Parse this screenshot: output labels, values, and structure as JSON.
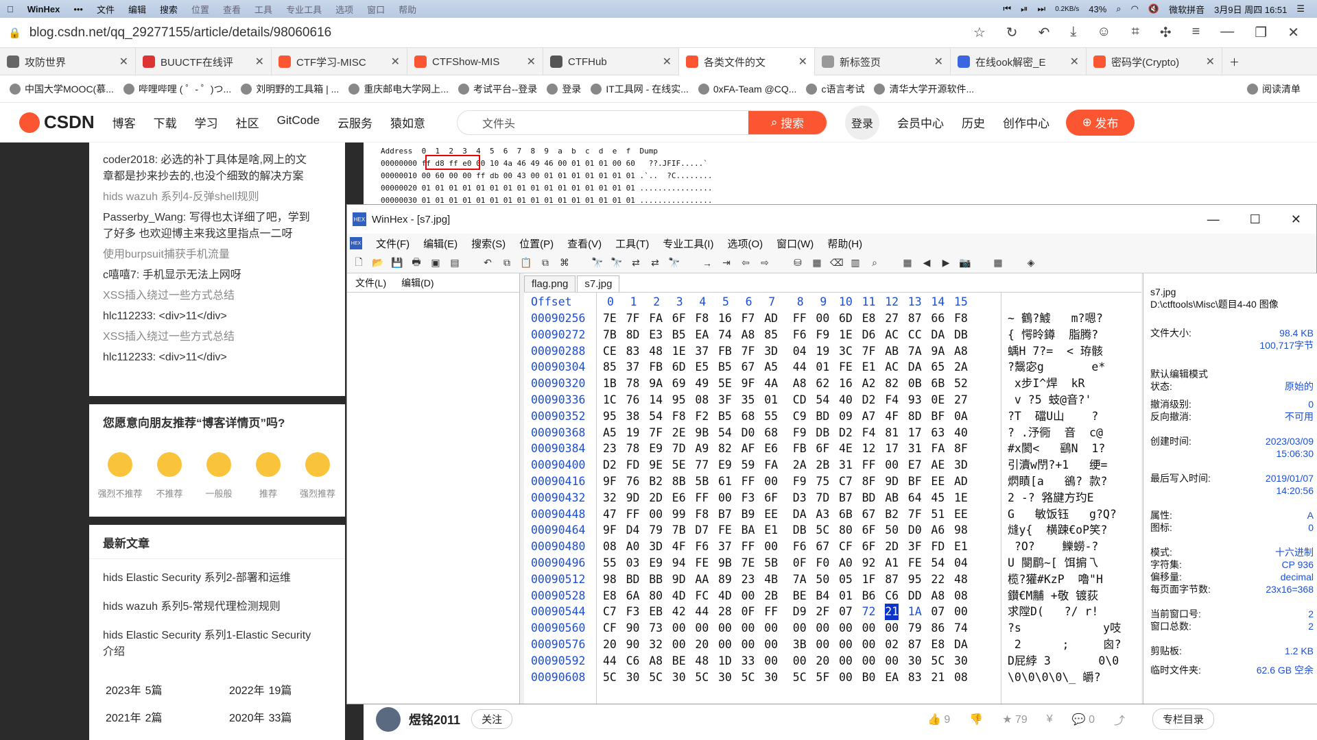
{
  "system": {
    "app_name": "WinHex",
    "menus": [
      "文件",
      "编辑",
      "搜索",
      "位置",
      "查看",
      "工具",
      "专业工具",
      "选项",
      "窗口",
      "帮助"
    ],
    "net_speed": "0.2KB/s",
    "battery": "43%",
    "ime": "微软拼音",
    "clock": "3月9日 周四 16:51"
  },
  "browser": {
    "url": "blog.csdn.net/qq_29277155/article/details/98060616",
    "tabs": [
      {
        "label": "攻防世界",
        "color": "#666"
      },
      {
        "label": "BUUCTF在线评",
        "color": "#d33"
      },
      {
        "label": "CTF学习-MISC",
        "color": "#fc5531"
      },
      {
        "label": "CTFShow-MIS",
        "color": "#fc5531"
      },
      {
        "label": "CTFHub",
        "color": "#555"
      },
      {
        "label": "各类文件的文",
        "color": "#fc5531"
      },
      {
        "label": "新标签页",
        "color": "#999"
      },
      {
        "label": "在线ook解密_E",
        "color": "#3a66e0"
      },
      {
        "label": "密码学(Crypto)",
        "color": "#fc5531"
      }
    ],
    "bookmarks": [
      "中国大学MOOC(慕...",
      "哔哩哔哩 ( ゜- ゜)つ...",
      "刘明野的工具箱 | ...",
      "重庆邮电大学网上...",
      "考试平台--登录",
      "登录",
      "IT工具网 - 在线实...",
      "0xFA-Team @CQ...",
      "c语言考试",
      "清华大学开源软件...",
      "阅读清单"
    ]
  },
  "csdn": {
    "logo": "CSDN",
    "nav": [
      "博客",
      "下载",
      "学习",
      "社区",
      "GitCode",
      "云服务",
      "猿如意"
    ],
    "search_placeholder": "文件头",
    "search_button": "搜索",
    "login": "登录",
    "right_nav": [
      "会员中心",
      "历史",
      "创作中心"
    ],
    "publish": "发布"
  },
  "sidebar": {
    "comments": [
      {
        "title": "coder2018: 必选的补丁具体是啥,网上的文",
        "title2": "章都是抄来抄去的,也没个细致的解决方案"
      },
      {
        "title": "hids wazuh 系列4-反弹shell规则"
      },
      {
        "title": "Passerby_Wang: 写得也太详细了吧，学到",
        "title2": "了好多 也欢迎博主来我这里指点一二呀"
      },
      {
        "title": "使用burpsuit捕获手机流量"
      },
      {
        "title": "c嘻嘻7: 手机显示无法上网呀"
      },
      {
        "title": "XSS插入绕过一些方式总结"
      },
      {
        "title": "hlc112233: <div>11</div>"
      },
      {
        "title": "XSS插入绕过一些方式总结"
      },
      {
        "title": "hlc112233: <div>11</div>"
      }
    ],
    "recommend_title": "您愿意向朋友推荐“博客详情页”吗?",
    "ratings": [
      "强烈不推荐",
      "不推荐",
      "一般般",
      "推荐",
      "强烈推荐"
    ],
    "latest_title": "最新文章",
    "latest": [
      "hids Elastic Security 系列2-部署和运维",
      "hids wazuh 系列5-常规代理检测规则",
      "hids Elastic Security 系列1-Elastic Security",
      "介绍"
    ],
    "archive": [
      {
        "year": "2023年",
        "count": "5篇"
      },
      {
        "year": "2022年",
        "count": "19篇"
      },
      {
        "year": "2021年",
        "count": "2篇"
      },
      {
        "year": "2020年",
        "count": "33篇"
      }
    ]
  },
  "snippet": {
    "header": "Address  0  1  2  3  4  5  6  7  8  9  a  b  c  d  e  f  Dump",
    "rows": [
      "00000000 ff d8 ff e0 00 10 4a 46 49 46 00 01 01 01 00 60   ??.JFIF.....`",
      "00000010 00 60 00 00 ff db 00 43 00 01 01 01 01 01 01 01 .`..  ?C........",
      "00000020 01 01 01 01 01 01 01 01 01 01 01 01 01 01 01 01 ................",
      "00000030 01 01 01 01 01 01 01 01 01 01 01 01 01 01 01 01 ................"
    ]
  },
  "author": {
    "name": "煜铭2011",
    "follow": "关注",
    "likes": "9",
    "stars": "79",
    "comments": "0",
    "column": "专栏目录"
  },
  "winhex": {
    "title": "WinHex - [s7.jpg]",
    "menu": [
      "文件(F)",
      "编辑(E)",
      "搜索(S)",
      "位置(P)",
      "查看(V)",
      "工具(T)",
      "专业工具(I)",
      "选项(O)",
      "窗口(W)",
      "帮助(H)"
    ],
    "left_menu": [
      "文件(L)",
      "编辑(D)"
    ],
    "file_tabs": [
      "flag.png",
      "s7.jpg"
    ],
    "offset_label": "Offset",
    "col_heads": [
      "0",
      "1",
      "2",
      "3",
      "4",
      "5",
      "6",
      "7",
      "8",
      "9",
      "10",
      "11",
      "12",
      "13",
      "14",
      "15"
    ],
    "rows": [
      {
        "off": "00090256",
        "bytes": [
          "7E",
          "7F",
          "FA",
          "6F",
          "F8",
          "16",
          "F7",
          "AD",
          "FF",
          "00",
          "6D",
          "E8",
          "27",
          "87",
          "66",
          "F8"
        ],
        "text": "~ 鶴?鰬   m?嗯?"
      },
      {
        "off": "00090272",
        "bytes": [
          "7B",
          "8D",
          "E3",
          "B5",
          "EA",
          "74",
          "A8",
          "85",
          "F6",
          "F9",
          "1E",
          "D6",
          "AC",
          "CC",
          "DA",
          "DB"
        ],
        "text": "{ 愕昤鐏  脂腾?"
      },
      {
        "off": "00090288",
        "bytes": [
          "CE",
          "83",
          "48",
          "1E",
          "37",
          "FB",
          "7F",
          "3D",
          "04",
          "19",
          "3C",
          "7F",
          "AB",
          "7A",
          "9A",
          "A8"
        ],
        "text": "蝺H 7?=  < 珔骸"
      },
      {
        "off": "00090304",
        "bytes": [
          "85",
          "37",
          "FB",
          "6D",
          "E5",
          "B5",
          "67",
          "A5",
          "44",
          "01",
          "FE",
          "E1",
          "AC",
          "DA",
          "65",
          "2A"
        ],
        "text": "?鬶宓g       e*"
      },
      {
        "off": "00090320",
        "bytes": [
          "1B",
          "78",
          "9A",
          "69",
          "49",
          "5E",
          "9F",
          "4A",
          "A8",
          "62",
          "16",
          "A2",
          "82",
          "0B",
          "6B",
          "52"
        ],
        "text": " x步I^焊  kR"
      },
      {
        "off": "00090336",
        "bytes": [
          "1C",
          "76",
          "14",
          "95",
          "08",
          "3F",
          "35",
          "01",
          "CD",
          "54",
          "40",
          "D2",
          "F4",
          "93",
          "0E",
          "27"
        ],
        "text": " v ?5 蚑@音?'"
      },
      {
        "off": "00090352",
        "bytes": [
          "95",
          "38",
          "54",
          "F8",
          "F2",
          "B5",
          "68",
          "55",
          "C9",
          "BD",
          "09",
          "A7",
          "4F",
          "8D",
          "BF",
          "0A"
        ],
        "text": "?T  礑U山    ?"
      },
      {
        "off": "00090368",
        "bytes": [
          "A5",
          "19",
          "7F",
          "2E",
          "9B",
          "54",
          "D0",
          "68",
          "F9",
          "DB",
          "D2",
          "F4",
          "81",
          "17",
          "63",
          "40"
        ],
        "text": "? .汿衕  音  c@"
      },
      {
        "off": "00090384",
        "bytes": [
          "23",
          "78",
          "E9",
          "7D",
          "A9",
          "82",
          "AF",
          "E6",
          "FB",
          "6F",
          "4E",
          "12",
          "17",
          "31",
          "FA",
          "8F"
        ],
        "text": "#x閡<   鷂N  1?"
      },
      {
        "off": "00090400",
        "bytes": [
          "D2",
          "FD",
          "9E",
          "5E",
          "77",
          "E9",
          "59",
          "FA",
          "2A",
          "2B",
          "31",
          "FF",
          "00",
          "E7",
          "AE",
          "3D"
        ],
        "text": "引瀆w閅?+1   绠="
      },
      {
        "off": "00090416",
        "bytes": [
          "9F",
          "76",
          "B2",
          "8B",
          "5B",
          "61",
          "FF",
          "00",
          "F9",
          "75",
          "C7",
          "8F",
          "9D",
          "BF",
          "EE",
          "AD"
        ],
        "text": "熌瞔[a   鵒? 款?"
      },
      {
        "off": "00090432",
        "bytes": [
          "32",
          "9D",
          "2D",
          "E6",
          "FF",
          "00",
          "F3",
          "6F",
          "D3",
          "7D",
          "B7",
          "BD",
          "AB",
          "64",
          "45",
          "1E"
        ],
        "text": "2 -? 嗠旔方玓E"
      },
      {
        "off": "00090448",
        "bytes": [
          "47",
          "FF",
          "00",
          "99",
          "F8",
          "B7",
          "B9",
          "EE",
          "DA",
          "A3",
          "6B",
          "67",
          "B2",
          "7F",
          "51",
          "EE"
        ],
        "text": "G   敏饭钰   g?Q?"
      },
      {
        "off": "00090464",
        "bytes": [
          "9F",
          "D4",
          "79",
          "7B",
          "D7",
          "FE",
          "BA",
          "E1",
          "DB",
          "5C",
          "80",
          "6F",
          "50",
          "D0",
          "A6",
          "98"
        ],
        "text": "熢y{  横踈€oP笑?"
      },
      {
        "off": "00090480",
        "bytes": [
          "08",
          "A0",
          "3D",
          "4F",
          "F6",
          "37",
          "FF",
          "00",
          "F6",
          "67",
          "CF",
          "6F",
          "2D",
          "3F",
          "FD",
          "E1"
        ],
        "text": " ?O?    鱳蟧-?"
      },
      {
        "off": "00090496",
        "bytes": [
          "55",
          "03",
          "E9",
          "94",
          "FE",
          "9B",
          "7E",
          "5B",
          "0F",
          "F0",
          "A0",
          "92",
          "A1",
          "FE",
          "54",
          "04"
        ],
        "text": "U 閿鹛~[ 饵掮乁"
      },
      {
        "off": "00090512",
        "bytes": [
          "98",
          "BD",
          "BB",
          "9D",
          "AA",
          "89",
          "23",
          "4B",
          "7A",
          "50",
          "05",
          "1F",
          "87",
          "95",
          "22",
          "48"
        ],
        "text": "榄?獾#KzP  嚕\"H"
      },
      {
        "off": "00090528",
        "bytes": [
          "E8",
          "6A",
          "80",
          "4D",
          "FC",
          "4D",
          "00",
          "2B",
          "BE",
          "B4",
          "01",
          "B6",
          "C6",
          "DD",
          "A8",
          "08"
        ],
        "text": "鑚€M黼 +敬 镀荻"
      },
      {
        "off": "00090544",
        "bytes": [
          "C7",
          "F3",
          "EB",
          "42",
          "44",
          "28",
          "0F",
          "FF",
          "D9",
          "2F",
          "07",
          "72",
          "21",
          "1A",
          "07",
          "00"
        ],
        "text": "求隚D(   ?/ r!"
      },
      {
        "off": "00090560",
        "bytes": [
          "CF",
          "90",
          "73",
          "00",
          "00",
          "00",
          "00",
          "00",
          "00",
          "00",
          "00",
          "00",
          "00",
          "79",
          "86",
          "74"
        ],
        "text": "?s            y吱"
      },
      {
        "off": "00090576",
        "bytes": [
          "20",
          "90",
          "32",
          "00",
          "20",
          "00",
          "00",
          "00",
          "3B",
          "00",
          "00",
          "00",
          "02",
          "87",
          "E8",
          "DA"
        ],
        "text": " 2      ;     囪?"
      },
      {
        "off": "00090592",
        "bytes": [
          "44",
          "C6",
          "A8",
          "BE",
          "48",
          "1D",
          "33",
          "00",
          "00",
          "20",
          "00",
          "00",
          "00",
          "30",
          "5C",
          "30"
        ],
        "text": "D屁綍 3       0\\0"
      },
      {
        "off": "00090608",
        "bytes": [
          "5C",
          "30",
          "5C",
          "30",
          "5C",
          "30",
          "5C",
          "30",
          "5C",
          "5F",
          "00",
          "B0",
          "EA",
          "83",
          "21",
          "08"
        ],
        "text": "\\0\\0\\0\\0\\_ 皭?"
      }
    ],
    "info": {
      "filename": "s7.jpg",
      "path": "D:\\ctftools\\Misc\\题目4-40 图像",
      "size_label": "文件大小:",
      "size": "98.4 KB",
      "size_bytes": "100,717字节",
      "edit_mode_label": "默认编辑模式",
      "state_label": "状态:",
      "state": "原始的",
      "undo_label": "撤消级别:",
      "undo": "0",
      "redo_label": "反向撤消:",
      "redo": "不可用",
      "created_label": "创建时间:",
      "created_date": "2023/03/09",
      "created_time": "15:06:30",
      "written_label": "最后写入时间:",
      "written_date": "2019/01/07",
      "written_time": "14:20:56",
      "attr_label": "属性:",
      "attr": "A",
      "icon_label": "图标:",
      "icon": "0",
      "mode_label": "模式:",
      "mode": "十六进制",
      "charset_label": "字符集:",
      "charset": "CP 936",
      "offset_label": "偏移量:",
      "offset": "decimal",
      "bpp_label": "每页面字节数:",
      "bpp": "23x16=368",
      "cur_win_label": "当前窗口号:",
      "cur_win": "2",
      "win_total_label": "窗口总数:",
      "win_total": "2",
      "clip_label": "剪贴板:",
      "clip": "1.2 KB",
      "temp_label": "临时文件夹:",
      "temp": "62.6 GB 空余"
    }
  }
}
